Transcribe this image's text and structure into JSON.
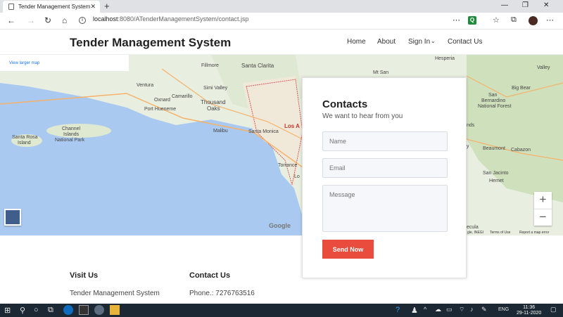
{
  "browser": {
    "tab_title": "Tender Management System",
    "url_host": "localhost",
    "url_path": ":8080/ATenderManagementSystem/contact.jsp",
    "ext_q_label": "Q"
  },
  "site": {
    "brand": "Tender Management System",
    "nav": [
      "Home",
      "About",
      "Sign In",
      "Contact Us"
    ]
  },
  "map": {
    "view_larger": "View larger map",
    "labels": [
      "Fillmore",
      "Santa Clarita",
      "Hesperia",
      "Ventura",
      "Simi Valley",
      "Oxnard",
      "Camarillo",
      "Thousand",
      "Oaks",
      "Port Hueneme",
      "Malibu",
      "Santa Monica",
      "Los A",
      "Torrance",
      "Lo",
      "Channel",
      "Islands",
      "National Park",
      "Santa Rosa",
      "Island",
      "Big Bear",
      "San",
      "Bernardino",
      "National Forest",
      "Beaumont",
      "Cabazon",
      "San Jacinto",
      "Hemet",
      "Mt San",
      "Valley",
      "ecula",
      "nds",
      "y"
    ],
    "zoom_in": "+",
    "zoom_out": "−",
    "google": "Google",
    "footer": [
      "gle, INEGI",
      "Terms of Use",
      "Report a map error"
    ]
  },
  "contact": {
    "title": "Contacts",
    "subtitle": "We want to hear from you",
    "name_placeholder": "Name",
    "email_placeholder": "Email",
    "message_placeholder": "Message",
    "send": "Send Now"
  },
  "footer": {
    "visit_title": "Visit Us",
    "visit_text": "Tender Management System",
    "contact_title": "Contact Us",
    "phone": "Phone.: 7276763516"
  },
  "taskbar": {
    "lang": "ENG",
    "time": "11:36",
    "date": "29-11-2020"
  },
  "colors": {
    "accent": "#e94b3c",
    "water": "#a9c9f0",
    "land": "#e8eee0",
    "taskbar": "#1c2833"
  }
}
